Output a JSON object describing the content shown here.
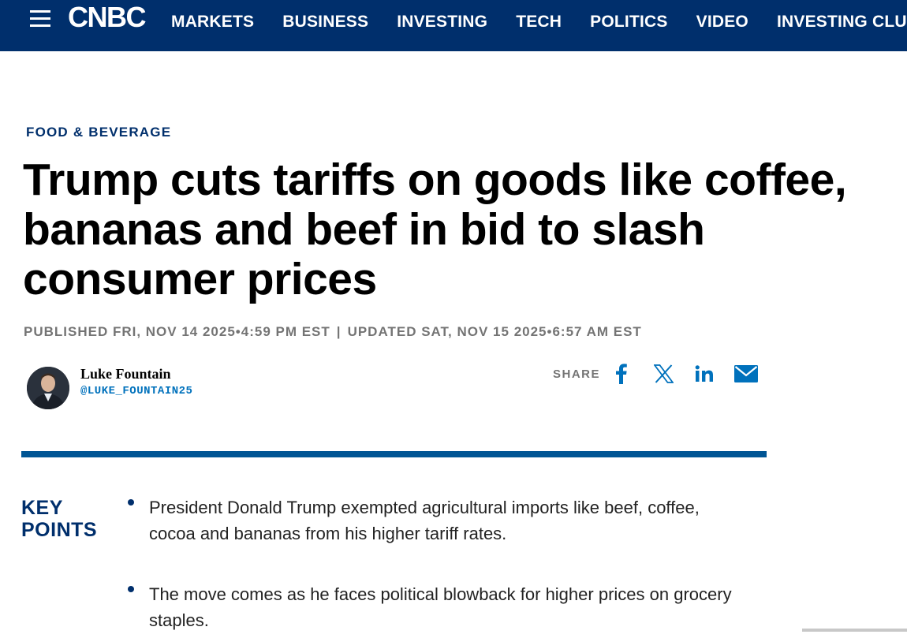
{
  "nav": {
    "logo": "CNBC",
    "items": [
      "MARKETS",
      "BUSINESS",
      "INVESTING",
      "TECH",
      "POLITICS",
      "VIDEO",
      "INVESTING CLUB"
    ]
  },
  "article": {
    "eyebrow": "FOOD & BEVERAGE",
    "headline": "Trump cuts tariffs on goods like coffee, bananas and beef in bid to slash consumer prices",
    "published": "PUBLISHED FRI, NOV 14 2025•4:59 PM EST",
    "separator": "|",
    "updated": "UPDATED SAT, NOV 15 2025•6:57 AM EST"
  },
  "author": {
    "name": "Luke Fountain",
    "handle": "@LUKE_FOUNTAIN25"
  },
  "share": {
    "label": "SHARE",
    "icons": [
      "facebook-icon",
      "x-icon",
      "linkedin-icon",
      "email-icon"
    ]
  },
  "key_points": {
    "title_line1": "KEY",
    "title_line2": "POINTS",
    "items": [
      "President Donald Trump exempted agricultural imports like beef, coffee, cocoa and bananas from his higher tariff rates.",
      "The move comes as he faces political blowback for higher prices on grocery staples."
    ]
  },
  "colors": {
    "nav_bg": "#002f6c",
    "accent_blue": "#0071bc",
    "divider": "#005594",
    "meta_gray": "#747474"
  }
}
